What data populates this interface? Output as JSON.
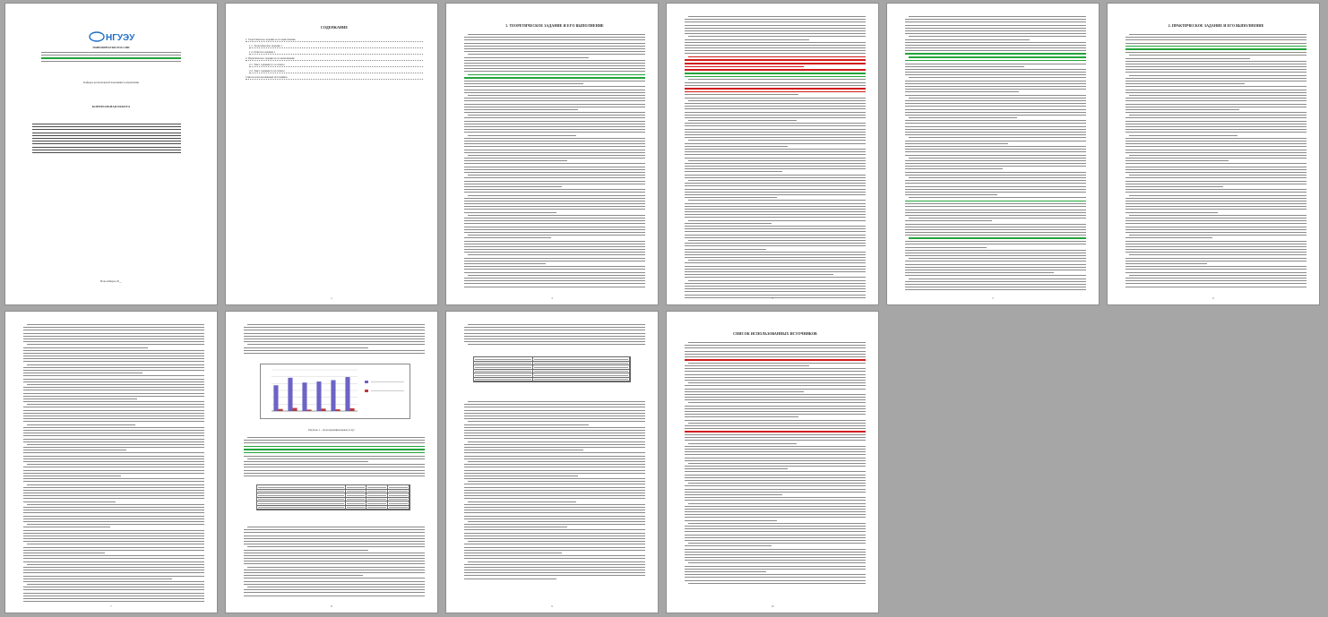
{
  "pages": [
    {
      "number": "",
      "title": ""
    },
    {
      "number": "2",
      "title": "СОДЕРЖАНИЕ"
    },
    {
      "number": "3",
      "title": "1. ТЕОРЕТИЧЕСКОЕ ЗАДАНИЕ И ЕГО ВЫПОЛНЕНИЕ"
    },
    {
      "number": "4",
      "title": ""
    },
    {
      "number": "5",
      "title": ""
    },
    {
      "number": "6",
      "title": "2. ПРАКТИЧЕСКОЕ ЗАДАНИЕ И ЕГО ВЫПОЛНЕНИЕ"
    },
    {
      "number": "7",
      "title": ""
    },
    {
      "number": "8",
      "title": ""
    },
    {
      "number": "9",
      "title": ""
    },
    {
      "number": "10",
      "title": "СПИСОК ИСПОЛЬЗОВАННЫХ ИСТОЧНИКОВ"
    }
  ],
  "cover": {
    "ministry": "МИНОБРНАУКИ РОССИИ",
    "department": "Кафедра региональной экономики и управления",
    "work_type": "КОНТРОЛЬНАЯ РАБОТА",
    "city_year": "Новосибирск 20__"
  },
  "toc": {
    "items": [
      "1. Теоретическое задание и его выполнение",
      "1.1. Теоретическое задание 1",
      "1.2. Ответ на задание 1",
      "2. Практическое задание и его выполнение",
      "2.1. Текст задания 2.1 и ответы",
      "2.2. Текст задания 2.2 и ответы",
      "Список использованных источников"
    ]
  },
  "chart_caption": "Рисунок 1 – Доля муниципальных услуг",
  "chart_data": {
    "type": "bar",
    "categories": [
      "1",
      "2",
      "3",
      "4",
      "5",
      "6"
    ],
    "series": [
      {
        "values": [
          75,
          97,
          83,
          86,
          90,
          99
        ]
      },
      {
        "values": [
          6,
          9,
          4,
          7,
          5,
          8
        ]
      }
    ],
    "ylim": [
      0,
      120
    ]
  }
}
